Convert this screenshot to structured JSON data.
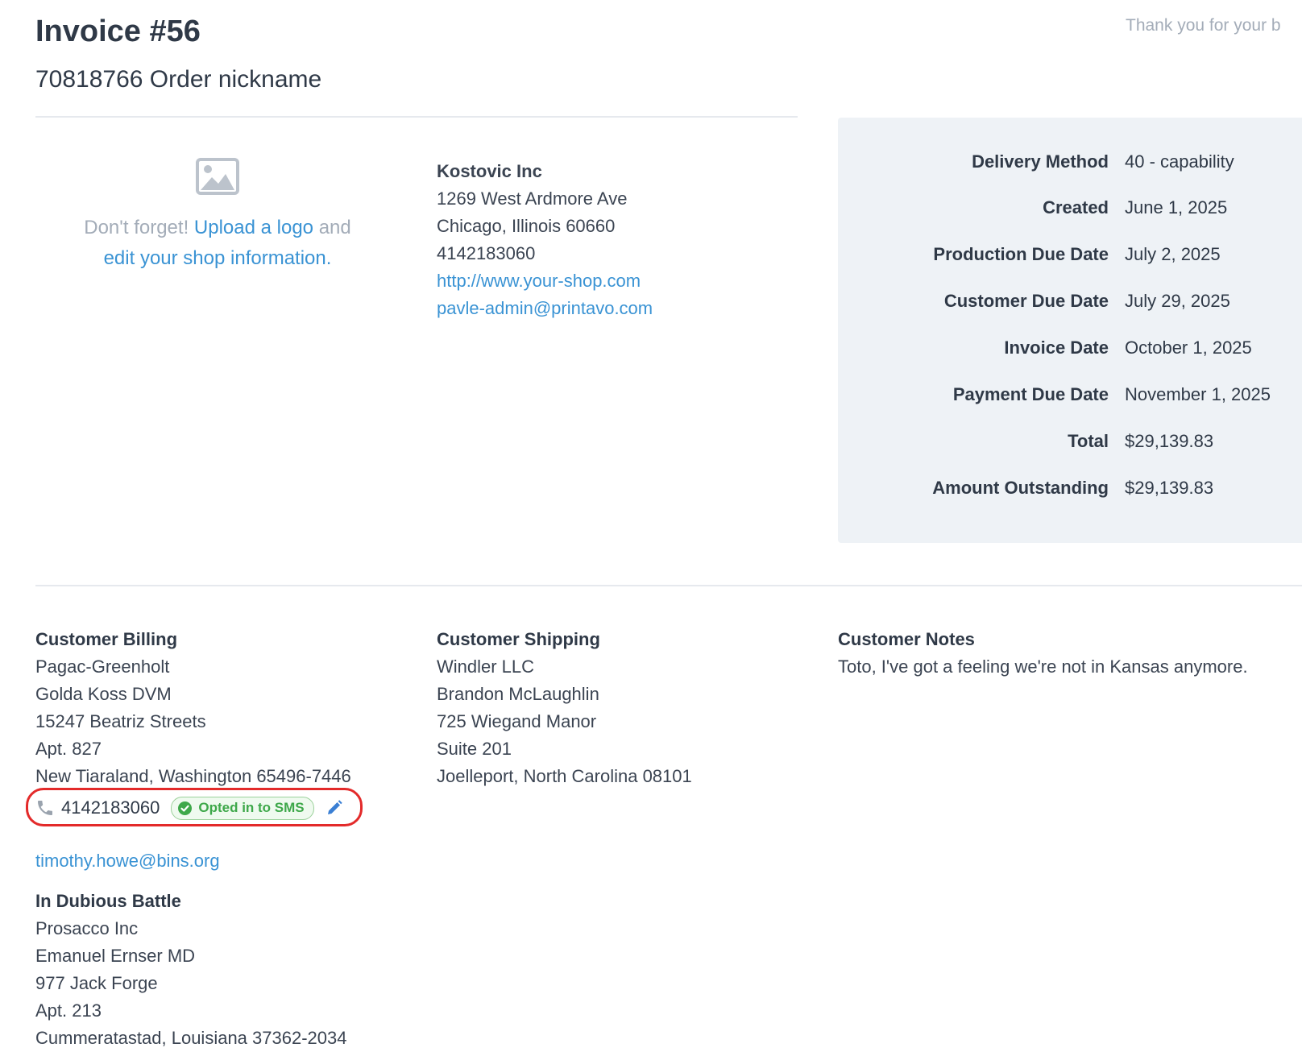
{
  "header": {
    "title": "Invoice #56",
    "subtitle": "70818766 Order nickname",
    "thanks": "Thank you for your b"
  },
  "logo_prompt": {
    "icon": "image-placeholder-icon",
    "prefix": "Don't forget!",
    "upload_link": "Upload a logo",
    "middle": "and",
    "edit_link": "edit your shop information."
  },
  "shop": {
    "name": "Kostovic Inc",
    "address1": "1269 West Ardmore Ave",
    "city_line": "Chicago, Illinois 60660",
    "phone": "4142183060",
    "website": "http://www.your-shop.com",
    "email": "pavle-admin@printavo.com"
  },
  "summary": [
    {
      "label": "Delivery Method",
      "value": "40 - capability"
    },
    {
      "label": "Created",
      "value": "June 1, 2025"
    },
    {
      "label": "Production Due Date",
      "value": "July 2, 2025"
    },
    {
      "label": "Customer Due Date",
      "value": "July 29, 2025"
    },
    {
      "label": "Invoice Date",
      "value": "October 1, 2025"
    },
    {
      "label": "Payment Due Date",
      "value": "November 1, 2025"
    },
    {
      "label": "Total",
      "value": "$29,139.83"
    },
    {
      "label": "Amount Outstanding",
      "value": "$29,139.83"
    }
  ],
  "billing": {
    "heading": "Customer Billing",
    "lines": [
      "Pagac-Greenholt",
      "Golda Koss DVM",
      "15247 Beatriz Streets",
      "Apt. 827",
      "New Tiaraland, Washington 65496-7446"
    ],
    "phone": "4142183060",
    "sms_badge": "Opted in to SMS",
    "email": "timothy.howe@bins.org"
  },
  "shipping": {
    "heading": "Customer Shipping",
    "lines": [
      "Windler LLC",
      "Brandon McLaughlin",
      "725 Wiegand Manor",
      "Suite 201",
      "Joelleport, North Carolina 08101"
    ]
  },
  "notes": {
    "heading": "Customer Notes",
    "text": "Toto, I've got a feeling we're not in Kansas anymore."
  },
  "secondary": {
    "heading": "In Dubious Battle",
    "lines": [
      "Prosacco Inc",
      "Emanuel Ernser MD",
      "977 Jack Forge",
      "Apt. 213",
      "Cummeratastad, Louisiana 37362-2034"
    ]
  },
  "colors": {
    "link": "#3a93d4",
    "badge_green": "#3ea84a",
    "highlight_red": "#e32a2a",
    "summary_bg": "#eef2f6"
  }
}
